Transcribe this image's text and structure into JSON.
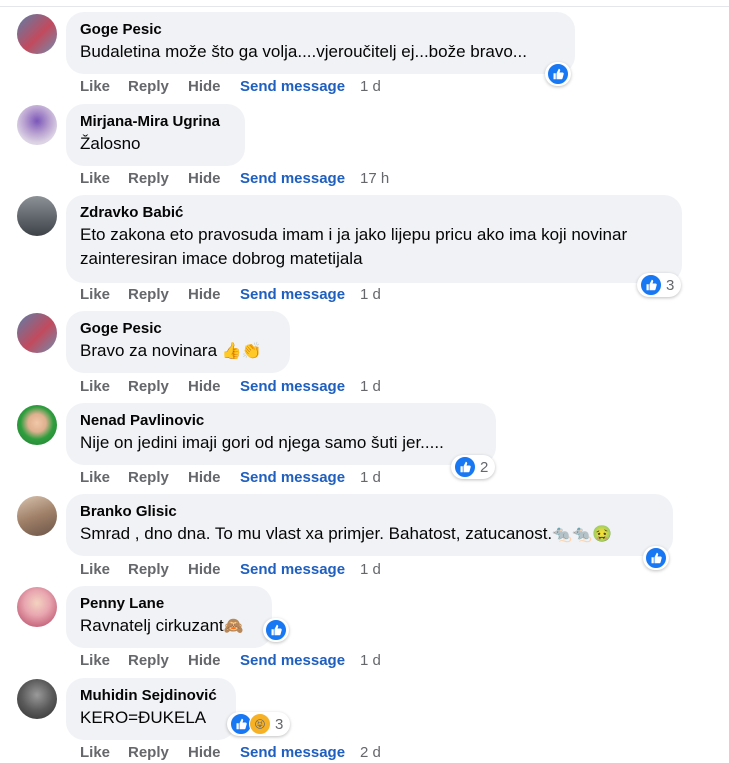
{
  "actions": {
    "like": "Like",
    "reply": "Reply",
    "hide": "Hide",
    "send_message": "Send message"
  },
  "colors": {
    "like_blue": "#1877f2",
    "send_blue": "#1f5fbf",
    "bubble": "#f0f2f5",
    "gray": "#65676b"
  },
  "comments": [
    {
      "author": "Goge Pesic",
      "text": "Budaletina može što ga volja....vjeroučitelj ej...bože bravo...",
      "time": "1 d",
      "reaction_count": ""
    },
    {
      "author": "Mirjana-Mira Ugrina",
      "text": "Žalosno",
      "time": "17 h",
      "reaction_count": ""
    },
    {
      "author": "Zdravko Babić",
      "text": "Eto zakona eto pravosuda imam i ja jako lijepu pricu ako ima koji novinar zainteresiran imace dobrog matetijala",
      "time": "1 d",
      "reaction_count": "3"
    },
    {
      "author": "Goge Pesic",
      "text": "Bravo za novinara",
      "emoji": "👍👏",
      "time": "1 d",
      "reaction_count": ""
    },
    {
      "author": "Nenad Pavlinovic",
      "text": "Nije on jedini imaji gori od njega samo šuti jer.....",
      "time": "1 d",
      "reaction_count": "2"
    },
    {
      "author": "Branko Glisic",
      "text": "Smrad , dno dna. To mu vlast xa primjer. Bahatost, zatucanost.",
      "emoji": "🐀🐀🤢",
      "time": "1 d",
      "reaction_count": ""
    },
    {
      "author": "Penny Lane",
      "text": "Ravnatelj cirkuzant",
      "emoji": "🙈",
      "time": "1 d",
      "reaction_count": ""
    },
    {
      "author": "Muhidin Sejdinović",
      "text": "KERO=ĐUKELA",
      "time": "2 d",
      "reaction_count": "3"
    }
  ]
}
